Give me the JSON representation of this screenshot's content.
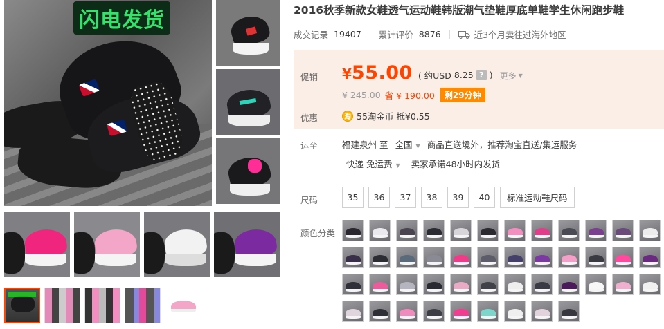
{
  "gallery": {
    "banner_text": "闪电发货",
    "thumbnail_count": 5
  },
  "product": {
    "title": "2016秋季新款女鞋透气运动鞋韩版潮气垫鞋厚底单鞋学生休闲跑步鞋",
    "sales_label": "成交记录",
    "sales_count": "19407",
    "reviews_label": "累计评价",
    "reviews_count": "8876",
    "overseas_text": "近3个月卖往过海外地区"
  },
  "price": {
    "promo_label": "促销",
    "currency_symbol": "¥",
    "current": "55.00",
    "usd_prefix": "( 约USD",
    "usd_value": "8.25",
    "usd_suffix": ")",
    "help_glyph": "?",
    "more_label": "更多",
    "original": "¥ 245.00",
    "save_text": "省 ¥ 190.00",
    "countdown": "剩29分钟",
    "discount_label": "优惠",
    "coin_glyph": "淘",
    "coin_text": "55淘金币",
    "coin_deduct": "抵¥0.55"
  },
  "shipping": {
    "label": "运至",
    "from": "福建泉州",
    "to_word": "至",
    "destination": "全国",
    "service_text": "商品直送境外，推荐淘宝直送/集运服务",
    "method": "快递",
    "fee": "免运费",
    "promise": "卖家承诺48小时内发货"
  },
  "sizes": {
    "label": "尺码",
    "options": [
      "35",
      "36",
      "37",
      "38",
      "39",
      "40"
    ],
    "chart_label": "标准运动鞋尺码"
  },
  "colors": {
    "label": "颜色分类",
    "swatches": [
      "#2a2730",
      "#e9e9ee",
      "#4a4350",
      "#2b2b33",
      "#d7d4da",
      "#2a2a30",
      "#f28fc0",
      "#e23d8a",
      "#4a4a55",
      "#7a3f8e",
      "#6a4a7a",
      "#ececec",
      "#3a2f48",
      "#2c2c34",
      "#5a6a7a",
      "#8a8a94",
      "#ee3c88",
      "#5c5c6a",
      "#45406a",
      "#7a3aa0",
      "#f2a0c8",
      "#3a3a42",
      "#ff4aa0",
      "#6a2a80",
      "#30303a",
      "#ec5c9c",
      "#b5b5c0",
      "#2a2a32",
      "#e8aac4",
      "#404048",
      "#eeeeee",
      "#3a3a44",
      "#4a1a5a",
      "#f7f7f7",
      "#efb0cf",
      "#f0f0f0",
      "#dfd5dc",
      "#2f2f37",
      "#f08bbd",
      "#3d3d45",
      "#f13c90",
      "#7dd6cc",
      "#efefef",
      "#e2d2dc",
      "#37373f"
    ]
  },
  "theme": {
    "accent": "#ff4400",
    "price_bg": "#fbeee6",
    "countdown_bg": "#ff8a00",
    "coin": "#fcb500"
  }
}
